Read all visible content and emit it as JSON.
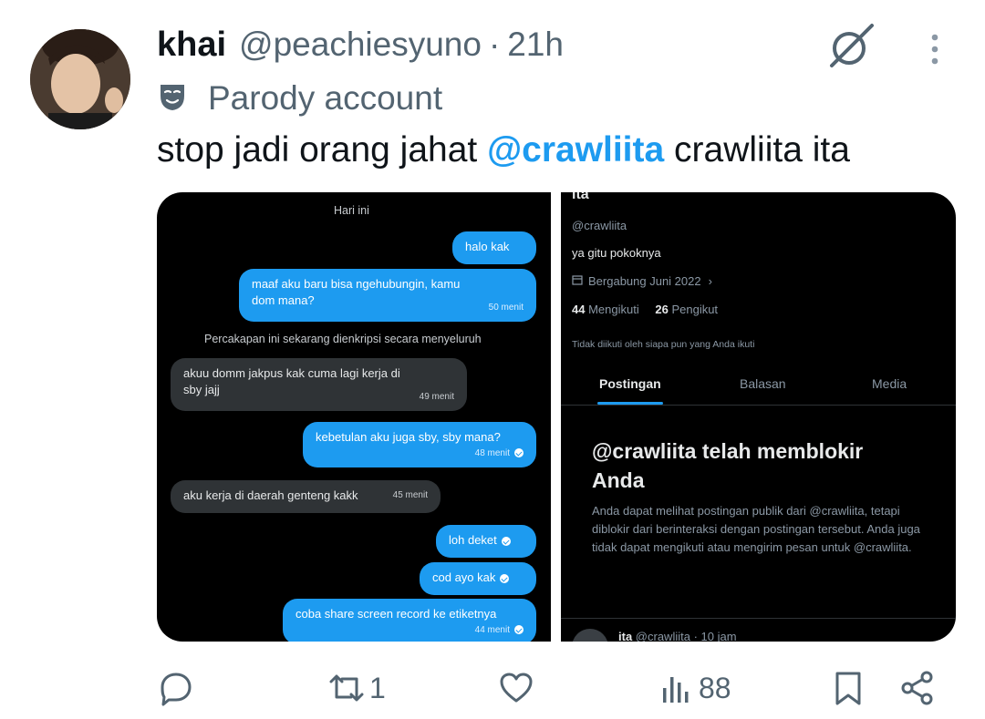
{
  "author": {
    "name": "khai",
    "handle": "@peachiesyuno",
    "separator": "·",
    "time": "21h",
    "label": "Parody account"
  },
  "tweet": {
    "text_before": "stop jadi orang jahat ",
    "mention": "@crawliita",
    "text_after": " crawliita ita"
  },
  "media": {
    "left": {
      "header": "Hari ini",
      "messages": [
        {
          "text": "halo kak",
          "meta": ""
        },
        {
          "text": "maaf aku baru bisa ngehubungin, kamu dom mana?",
          "meta": "50 menit"
        },
        {
          "text": "akuu domm jakpus kak cuma lagi kerja di sby jajj",
          "meta": "49 menit"
        },
        {
          "text": "kebetulan aku juga sby, sby mana?",
          "meta": "48 menit"
        },
        {
          "text": "aku kerja di daerah genteng kakk",
          "meta": "45 menit"
        },
        {
          "text": "loh deket",
          "meta": ""
        },
        {
          "text": "cod ayo kak",
          "meta": ""
        },
        {
          "text": "coba share screen record ke etiketnya",
          "meta": "44 menit"
        }
      ],
      "encrypted_notice": "Percakapan ini sekarang dienkripsi secara menyeluruh"
    },
    "right": {
      "name": "ita",
      "handle": "@crawliita",
      "bio": "ya gitu pokoknya",
      "joined": "Bergabung Juni 2022",
      "following_count": "44",
      "following_label": "Mengikuti",
      "followers_count": "26",
      "followers_label": "Pengikut",
      "not_followed": "Tidak diikuti oleh siapa pun yang Anda ikuti",
      "tabs": [
        "Postingan",
        "Balasan",
        "Media"
      ],
      "blocked_title": "@crawliita telah memblokir Anda",
      "blocked_body": "Anda dapat melihat postingan publik dari @crawliita, tetapi diblokir dari berinteraksi dengan postingan tersebut. Anda juga tidak dapat mengikuti atau mengirim pesan untuk @crawliita.",
      "bottom_name": "ita",
      "bottom_handle": "@crawliita",
      "bottom_time": "· 10 jam"
    }
  },
  "actions": {
    "reply_count": "",
    "repost_count": "1",
    "like_count": "",
    "views_count": "88"
  },
  "colors": {
    "accent": "#1d9bf0",
    "text": "#0f1419",
    "secondary": "#536471"
  }
}
